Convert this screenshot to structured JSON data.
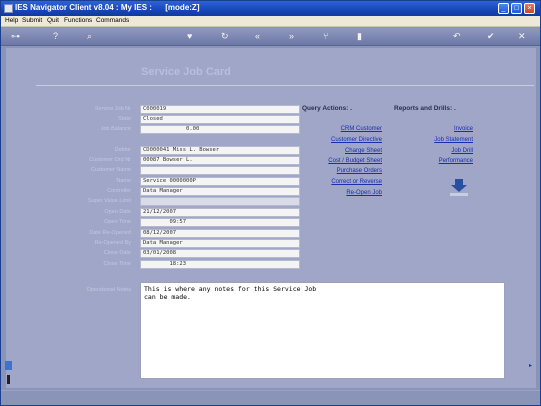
{
  "window": {
    "title": "IES Navigator Client v8.04 : My IES :      [mode:Z]"
  },
  "menu": [
    "Help",
    "Submit",
    "Quit",
    "Functions",
    "Commands"
  ],
  "toolbar_icons": [
    "key-icon",
    "help-icon",
    "search-icon",
    "heart-icon",
    "refresh-icon",
    "back-icon",
    "forward-icon",
    "tree-icon",
    "save-icon",
    "undo-icon",
    "ok-icon",
    "close-icon"
  ],
  "page": {
    "title": "Service Job Card"
  },
  "fields": [
    {
      "label": "Service Job Nr",
      "value": "C000019",
      "grey": false
    },
    {
      "label": "State",
      "value": "Closed",
      "grey": false
    },
    {
      "label": "Job Balance",
      "value": "             0.00",
      "grey": false
    },
    {
      "label": "Debtor",
      "value": "CD000041 Miss L. Bowser",
      "grey": false
    },
    {
      "label": "Customer Ord Nr",
      "value": "00087 Bowser L.",
      "grey": false
    },
    {
      "label": "Customer Name",
      "value": "",
      "grey": false
    },
    {
      "label": "Name",
      "value": "Service 0000000P",
      "grey": false
    },
    {
      "label": "Controller",
      "value": "Data Manager",
      "grey": false
    },
    {
      "label": "Super Value Limit",
      "value": "",
      "grey": true
    },
    {
      "label": "Open Date",
      "value": "21/12/2007",
      "grey": false
    },
    {
      "label": "Open Time",
      "value": "        09:57",
      "grey": false
    },
    {
      "label": "Date Re-Opened",
      "value": "08/12/2007",
      "grey": false
    },
    {
      "label": "Re-Opened By",
      "value": "Data Manager",
      "grey": false
    },
    {
      "label": "Close Date",
      "value": "03/01/2008",
      "grey": false
    },
    {
      "label": "Close Time",
      "value": "        18:23",
      "grey": false
    }
  ],
  "query_actions": {
    "heading": "Query Actions: .",
    "links": [
      "CRM Customer",
      "Customer Directive",
      "Charge Sheet",
      "Cost / Budget Sheet",
      "Purchase Orders",
      "Correct or Reverse",
      "Re-Open Job"
    ]
  },
  "reports": {
    "heading": "Reports and Drills: .",
    "links": [
      "Invoice",
      "Job Statement",
      "Job Drill",
      "Performance"
    ]
  },
  "notes": {
    "label": "Operational Notes",
    "text": "This is where any notes for this Service Job\ncan be made."
  },
  "colors": {
    "titlebar": "#1746b8",
    "background": "#9fa6c8",
    "link": "#1a2fb0"
  }
}
